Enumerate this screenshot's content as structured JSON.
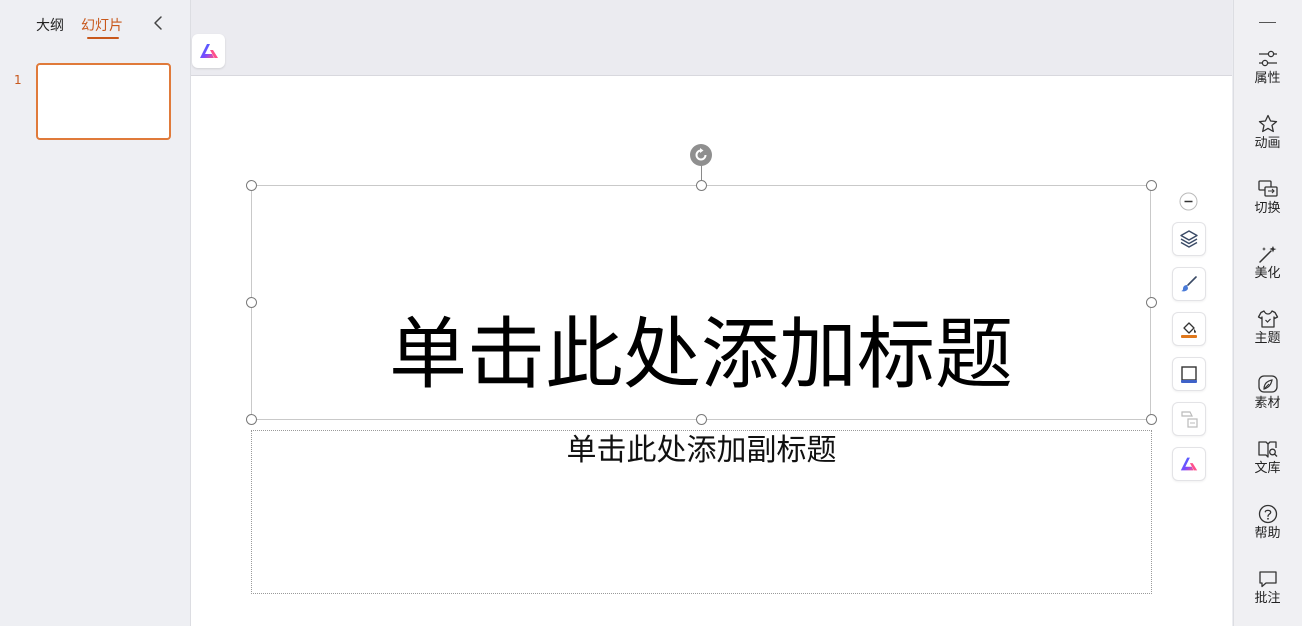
{
  "left_panel": {
    "tabs": [
      {
        "label": "大纲"
      },
      {
        "label": "幻灯片"
      }
    ],
    "slides": [
      {
        "number": "1"
      }
    ]
  },
  "slide": {
    "title_placeholder": "单击此处添加标题",
    "subtitle_placeholder": "单击此处添加副标题"
  },
  "right_sidebar": {
    "items": [
      {
        "label": "属性",
        "icon": "properties-icon"
      },
      {
        "label": "动画",
        "icon": "animation-icon"
      },
      {
        "label": "切换",
        "icon": "transition-icon"
      },
      {
        "label": "美化",
        "icon": "beautify-icon"
      },
      {
        "label": "主题",
        "icon": "theme-icon"
      },
      {
        "label": "素材",
        "icon": "material-icon"
      },
      {
        "label": "文库",
        "icon": "library-icon"
      },
      {
        "label": "帮助",
        "icon": "help-icon"
      },
      {
        "label": "批注",
        "icon": "comment-icon"
      }
    ]
  },
  "floating_toolbar": {
    "tools": [
      "collapse-icon",
      "layers-icon",
      "brush-icon",
      "fill-color-icon",
      "border-icon",
      "shape-icon",
      "ai-icon"
    ]
  },
  "colors": {
    "accent": "#c8581c",
    "slide_bg": "#ffffff",
    "workspace_bg": "#ecedf1"
  }
}
